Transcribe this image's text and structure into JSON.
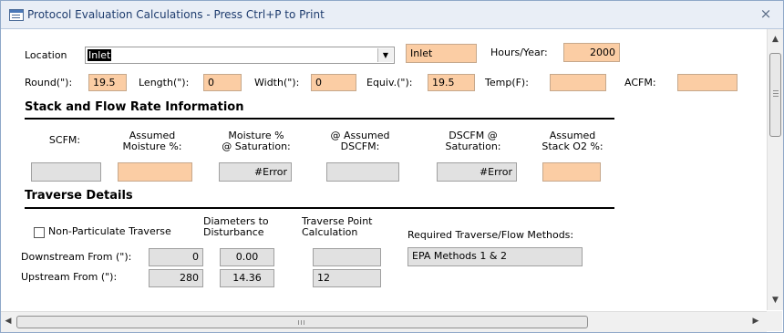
{
  "window": {
    "title": "Protocol Evaluation Calculations - Press Ctrl+P to Print",
    "close_glyph": "×"
  },
  "location": {
    "label": "Location",
    "combo_value": "Inlet",
    "display_value": "Inlet"
  },
  "hours_year": {
    "label": "Hours/Year:",
    "value": "2000"
  },
  "dimensions": {
    "round_label": "Round(\"):",
    "round_value": "19.5",
    "length_label": "Length(\"):",
    "length_value": "0",
    "width_label": "Width(\"):",
    "width_value": "0",
    "equiv_label": "Equiv.(\"):",
    "equiv_value": "19.5",
    "temp_label": "Temp(F):",
    "temp_value": "",
    "acfm_label": "ACFM:",
    "acfm_value": ""
  },
  "stack_section": {
    "title": "Stack and Flow Rate Information",
    "columns": [
      {
        "line1": "",
        "line2": "SCFM:",
        "value": ""
      },
      {
        "line1": "Assumed",
        "line2": "Moisture %:",
        "value": ""
      },
      {
        "line1": "Moisture %",
        "line2": "@ Saturation:",
        "value": "#Error"
      },
      {
        "line1": "@ Assumed",
        "line2": "DSCFM:",
        "value": ""
      },
      {
        "line1": "DSCFM @",
        "line2": "Saturation:",
        "value": "#Error"
      },
      {
        "line1": "Assumed",
        "line2": "Stack O2 %:",
        "value": ""
      }
    ]
  },
  "traverse_section": {
    "title": "Traverse Details",
    "non_particulate_label": "Non-Particulate Traverse",
    "non_particulate_checked": false,
    "diameters_header": [
      "Diameters to",
      "Disturbance"
    ],
    "point_calc_header": [
      "Traverse Point",
      "Calculation"
    ],
    "required_methods_label": "Required Traverse/Flow Methods:",
    "downstream_label": "Downstream From (\"):",
    "downstream_value": "0",
    "downstream_diameters": "0.00",
    "downstream_point_calc": "",
    "upstream_label": "Upstream From (\"):",
    "upstream_value": "280",
    "upstream_diameters": "14.36",
    "upstream_point_calc": "12",
    "required_methods_value": "EPA Methods 1 & 2"
  },
  "colors": {
    "input_fill": "#fbcda4",
    "readonly_fill": "#e1e1e1",
    "titlebar": "#e9eef6",
    "title_text": "#1e3c6e"
  },
  "icons": {
    "window_icon": "form-icon",
    "combo_arrow": "chevron-down-icon",
    "scroll_up": "arrow-up-icon",
    "scroll_down": "arrow-down-icon",
    "scroll_left": "arrow-left-icon",
    "scroll_right": "arrow-right-icon"
  }
}
